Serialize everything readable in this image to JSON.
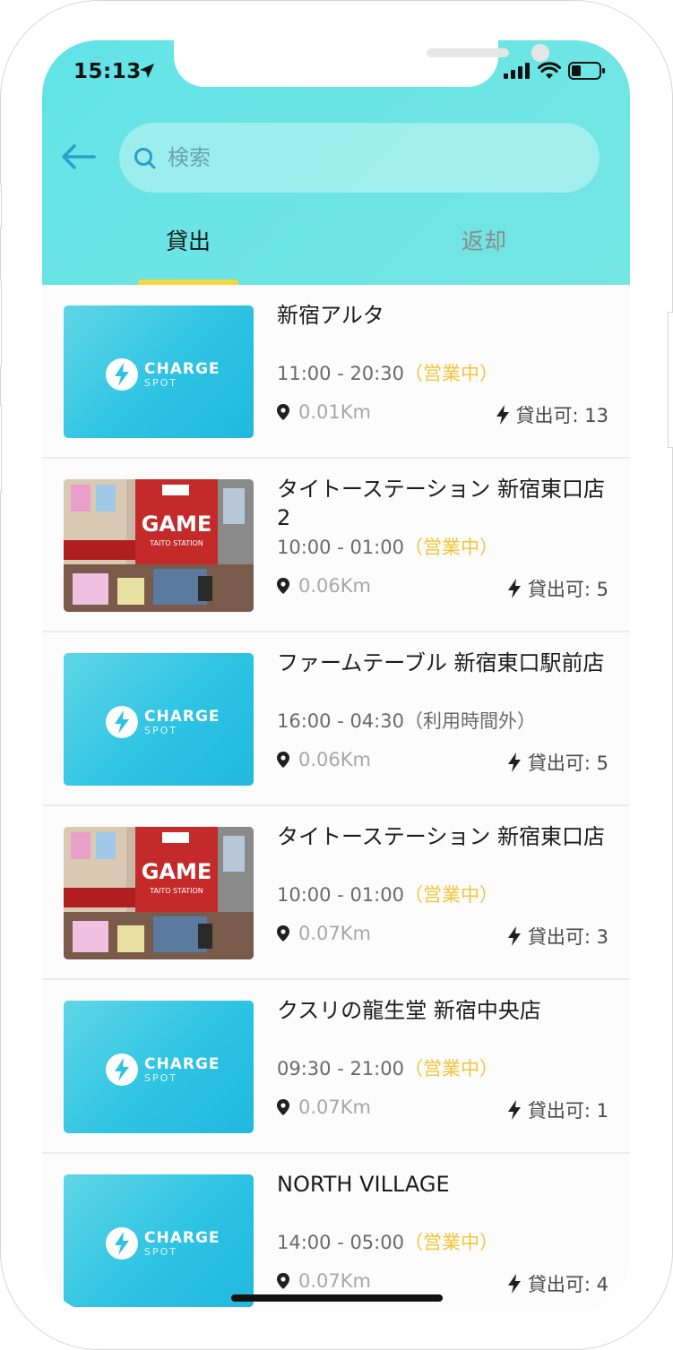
{
  "status_bar": {
    "time": "15:13"
  },
  "search": {
    "placeholder": "検索"
  },
  "tabs": [
    {
      "label": "貸出",
      "active": true
    },
    {
      "label": "返却",
      "active": false
    }
  ],
  "thumbnail_brand": {
    "line1": "CHARGE",
    "line2": "SPOT"
  },
  "photo_sign": {
    "main": "GAME",
    "sub": "TAITO STATION"
  },
  "colors": {
    "header": "#6ae4e4",
    "accent_tab": "#f5d540",
    "open_status": "#f0c63a"
  },
  "stores": [
    {
      "name": "新宿アルタ",
      "hours": "11:00 - 20:30",
      "status": "（営業中）",
      "distance": "0.01Km",
      "available": "貸出可: 13",
      "thumb": "chargespot"
    },
    {
      "name": "タイトーステーション 新宿東口店 2",
      "hours": "10:00 - 01:00",
      "status": "（営業中）",
      "distance": "0.06Km",
      "available": "貸出可: 5",
      "thumb": "photo"
    },
    {
      "name": "ファームテーブル 新宿東口駅前店",
      "hours": "16:00 - 04:30",
      "status": "（利用時間外）",
      "distance": "0.06Km",
      "available": "貸出可: 5",
      "thumb": "chargespot"
    },
    {
      "name": "タイトーステーション 新宿東口店",
      "hours": "10:00 - 01:00",
      "status": "（営業中）",
      "distance": "0.07Km",
      "available": "貸出可: 3",
      "thumb": "photo"
    },
    {
      "name": "クスリの龍生堂 新宿中央店",
      "hours": "09:30 - 21:00",
      "status": "（営業中）",
      "distance": "0.07Km",
      "available": "貸出可: 1",
      "thumb": "chargespot"
    },
    {
      "name": "NORTH VILLAGE",
      "hours": "14:00 - 05:00",
      "status": "（営業中）",
      "distance": "0.07Km",
      "available": "貸出可: 4",
      "thumb": "chargespot"
    }
  ]
}
